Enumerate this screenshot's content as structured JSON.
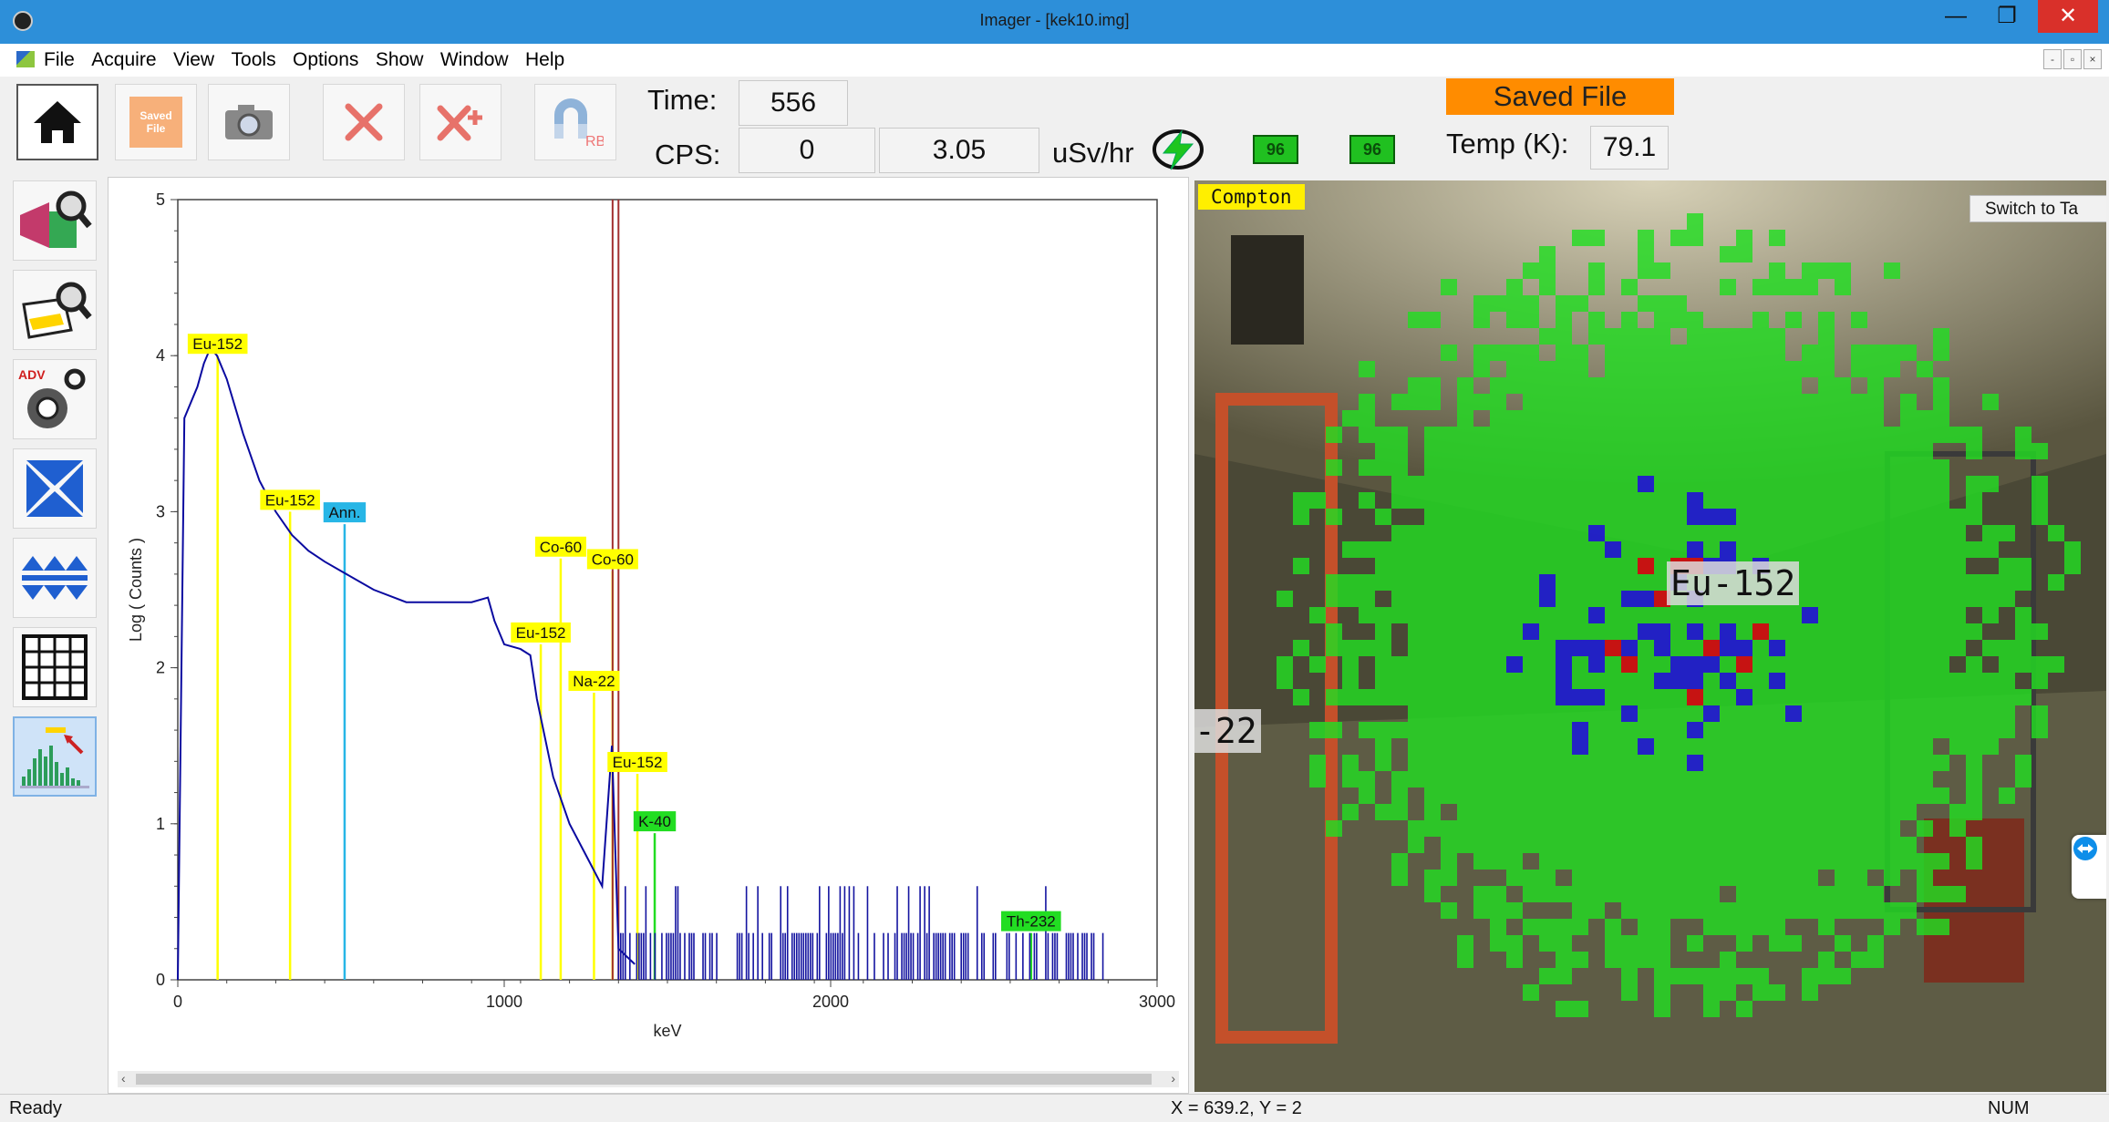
{
  "window": {
    "title": "Imager - [kek10.img]",
    "minimize": "—",
    "restore": "❐",
    "close": "✕"
  },
  "menu": {
    "items": [
      "File",
      "Acquire",
      "View",
      "Tools",
      "Options",
      "Show",
      "Window",
      "Help"
    ],
    "mdi": [
      "-",
      "▫",
      "×"
    ]
  },
  "toolbar": {
    "home_icon": "home-icon",
    "saved_file_button": "Saved File",
    "time_label": "Time:",
    "time_value": "556",
    "cps_label": "CPS:",
    "cps_value": "0",
    "dose_value": "3.05",
    "dose_unit": "uSv/hr",
    "chip1": "96",
    "chip2": "96",
    "saved_banner": "Saved File",
    "temp_label": "Temp (K):",
    "temp_value": "79.1",
    "rb_badge": "RB",
    "colors": {
      "banner": "#ff8c00",
      "chip": "#20c020"
    }
  },
  "sidebar": {
    "items": [
      "gamma-camera-search",
      "box-search",
      "advanced-settings",
      "collapse",
      "expand",
      "grid-view",
      "spectrum-view"
    ],
    "adv_badge": "ADV"
  },
  "chart_data": {
    "type": "line",
    "xlabel": "keV",
    "ylabel": "Log ( Counts )",
    "xlim": [
      0,
      3000
    ],
    "ylim": [
      0,
      5
    ],
    "xticks": [
      "0",
      "1000",
      "2000",
      "3000"
    ],
    "yticks": [
      "0",
      "1",
      "2",
      "3",
      "4",
      "5"
    ],
    "series": [
      {
        "color": "#0a0aa0",
        "x": [
          0,
          20,
          40,
          60,
          80,
          100,
          120,
          150,
          200,
          250,
          300,
          350,
          400,
          450,
          500,
          600,
          700,
          800,
          900,
          950,
          970,
          1000,
          1050,
          1080,
          1100,
          1150,
          1200,
          1250,
          1300,
          1330,
          1350,
          1400
        ],
        "y": [
          0,
          3.6,
          3.7,
          3.8,
          3.95,
          4.05,
          4.0,
          3.85,
          3.5,
          3.2,
          3.0,
          2.85,
          2.75,
          2.68,
          2.62,
          2.5,
          2.42,
          2.42,
          2.42,
          2.45,
          2.3,
          2.15,
          2.12,
          2.08,
          1.8,
          1.3,
          1.0,
          0.8,
          0.6,
          1.5,
          0.2,
          0.1
        ]
      }
    ],
    "annotations": [
      {
        "label": "Eu-152",
        "x": 122,
        "y": 4.0,
        "color": "#ffff00"
      },
      {
        "label": "Eu-152",
        "x": 344,
        "y": 3.0,
        "color": "#ffff00"
      },
      {
        "label": "Ann.",
        "x": 511,
        "y": 2.92,
        "color": "#27b6e6"
      },
      {
        "label": "Co-60",
        "x": 1173,
        "y": 2.7,
        "color": "#ffff00"
      },
      {
        "label": "Co-60",
        "x": 1332,
        "y": 2.62,
        "color": "#ffff00"
      },
      {
        "label": "Eu-152",
        "x": 1112,
        "y": 2.15,
        "color": "#ffff00"
      },
      {
        "label": "Na-22",
        "x": 1275,
        "y": 1.84,
        "color": "#ffff00"
      },
      {
        "label": "Eu-152",
        "x": 1408,
        "y": 1.32,
        "color": "#ffff00"
      },
      {
        "label": "K-40",
        "x": 1461,
        "y": 0.94,
        "color": "#22dd22"
      },
      {
        "label": "Th-232",
        "x": 2614,
        "y": 0.3,
        "color": "#22dd22"
      }
    ],
    "markers": [
      1332,
      1350
    ],
    "legend": "none",
    "grid": false
  },
  "image_view": {
    "mode_label": "Compton",
    "switch_button": "Switch to Ta",
    "iso_labels": [
      "Eu-152",
      "-22"
    ],
    "colors": {
      "low": "#22dd22",
      "mid": "#2020cc",
      "high": "#cc1111"
    }
  },
  "status": {
    "left": "Ready",
    "center": "X = 639.2, Y = 2",
    "right": "NUM"
  }
}
